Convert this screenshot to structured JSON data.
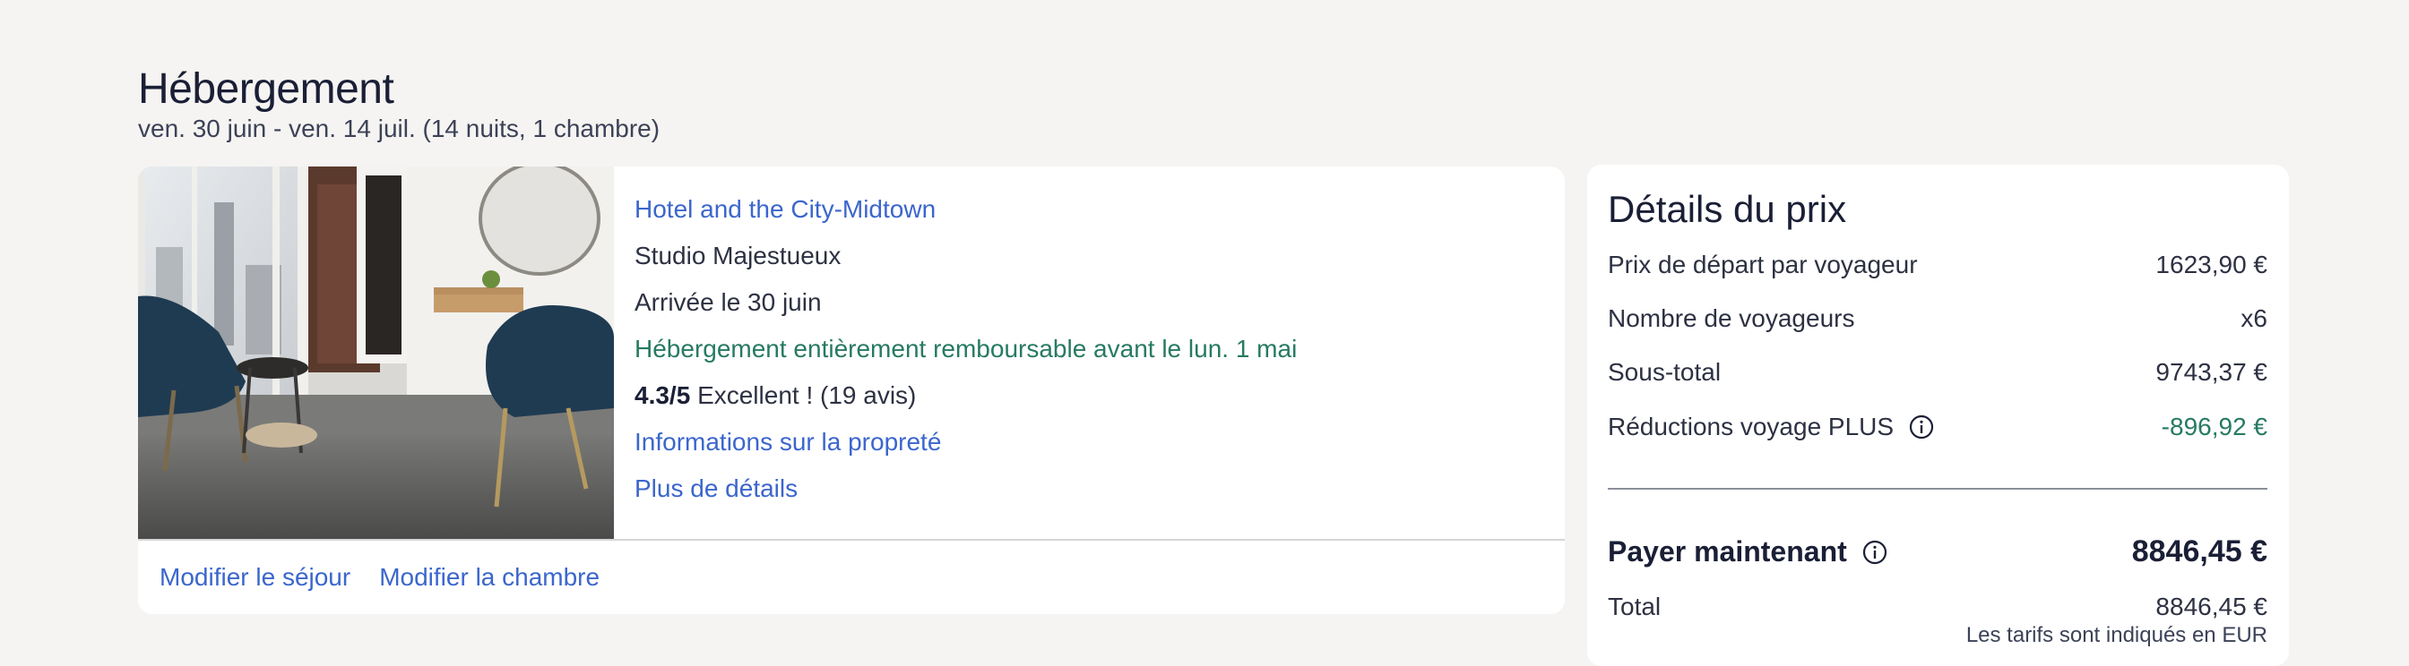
{
  "accommodation": {
    "title": "Hébergement",
    "dates": "ven. 30 juin - ven. 14 juil. (14 nuits, 1 chambre)"
  },
  "hotel": {
    "name": "Hotel and the City-Midtown",
    "room": "Studio Majestueux",
    "arrival": "Arrivée le 30 juin",
    "refund_policy": "Hébergement entièrement remboursable avant le lun. 1 mai",
    "rating_score": "4.3/5",
    "rating_text": "Excellent ! (19 avis)",
    "cleanliness_link": "Informations sur la propreté",
    "more_details_link": "Plus de détails",
    "actions": {
      "modify_stay": "Modifier le séjour",
      "modify_room": "Modifier la chambre"
    }
  },
  "price_details": {
    "title": "Détails du prix",
    "rows": [
      {
        "label": "Prix de départ par voyageur",
        "value": "1623,90 €"
      },
      {
        "label": "Nombre de voyageurs",
        "value": "x6"
      },
      {
        "label": "Sous-total",
        "value": "9743,37 €"
      },
      {
        "label": "Réductions voyage PLUS",
        "value": "-896,92 €"
      }
    ],
    "pay_now_label": "Payer maintenant",
    "pay_now_value": "8846,45 €",
    "total_label": "Total",
    "total_value": "8846,45 €",
    "currency_note": "Les tarifs sont indiqués en EUR"
  },
  "colors": {
    "link": "#3b66cc",
    "positive": "#277a62",
    "text": "#1a1f36",
    "background": "#f5f4f2"
  },
  "icons": [
    "info-icon"
  ]
}
